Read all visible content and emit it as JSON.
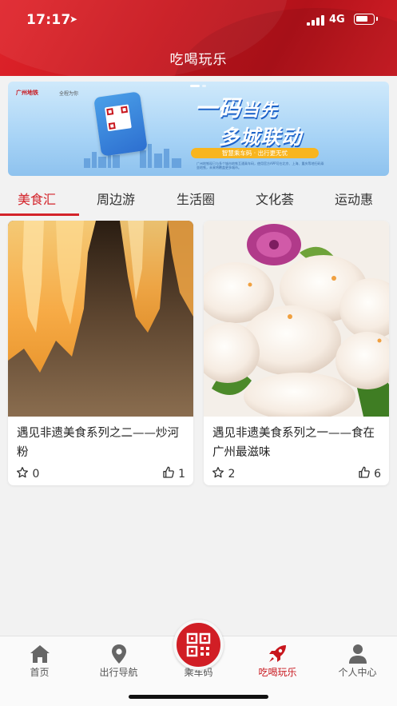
{
  "status_bar": {
    "time": "17:17",
    "network": "4G"
  },
  "header": {
    "title": "吃喝玩乐"
  },
  "banner": {
    "brand": "广州地铁",
    "slogan": "全程为你",
    "headline_1": "一码",
    "headline_1b": "当先",
    "headline_2": "多城联动",
    "pill": "智慧乘车码 · 出行更无忧",
    "fine_print": "广州地铁现已与多个城市地铁互通乘车码，使用官方APP可在北京、上海、重庆等地扫码乘坐地铁，未来将覆盖更多城市。"
  },
  "tabs": [
    {
      "label": "美食汇",
      "active": true
    },
    {
      "label": "周边游",
      "active": false
    },
    {
      "label": "生活圈",
      "active": false
    },
    {
      "label": "文化荟",
      "active": false
    },
    {
      "label": "运动惠",
      "active": false
    }
  ],
  "cards": [
    {
      "title": "遇见非遗美食系列之二——炒河粉",
      "favorites": "0",
      "likes": "1"
    },
    {
      "title": "遇见非遗美食系列之一——食在广州最滋味",
      "favorites": "2",
      "likes": "6"
    }
  ],
  "bottom_nav": [
    {
      "label": "首页",
      "icon": "home-icon",
      "active": false
    },
    {
      "label": "出行导航",
      "icon": "location-pin-icon",
      "active": false
    },
    {
      "label": "乘车码",
      "icon": "qr-code-icon",
      "active": false
    },
    {
      "label": "吃喝玩乐",
      "icon": "rocket-icon",
      "active": true
    },
    {
      "label": "个人中心",
      "icon": "person-icon",
      "active": false
    }
  ],
  "colors": {
    "brand_red": "#c8161d",
    "active_tab": "#d3232a"
  }
}
